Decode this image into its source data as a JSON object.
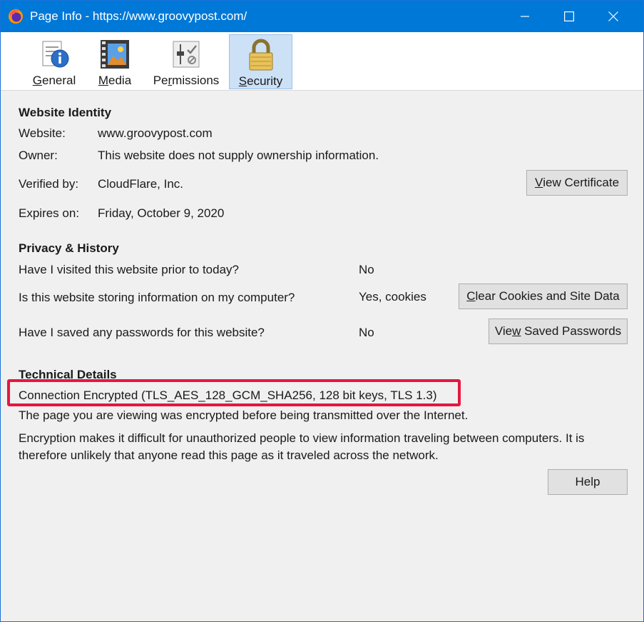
{
  "window": {
    "title": "Page Info - https://www.groovypost.com/",
    "app_icon": "firefox-icon",
    "controls": {
      "minimize": "minimize-icon",
      "maximize": "maximize-icon",
      "close": "close-icon"
    }
  },
  "tabs": [
    {
      "id": "general",
      "label_u": "G",
      "label_rest": "eneral",
      "icon": "info-icon",
      "selected": false
    },
    {
      "id": "media",
      "label_u": "M",
      "label_rest": "edia",
      "icon": "media-icon",
      "selected": false
    },
    {
      "id": "permissions",
      "label_pre": "Pe",
      "label_u": "r",
      "label_rest": "missions",
      "icon": "permissions-icon",
      "selected": false
    },
    {
      "id": "security",
      "label_u": "S",
      "label_rest": "ecurity",
      "icon": "lock-icon",
      "selected": true
    }
  ],
  "identity": {
    "heading": "Website Identity",
    "website_label": "Website:",
    "website_value": "www.groovypost.com",
    "owner_label": "Owner:",
    "owner_value": "This website does not supply ownership information.",
    "verified_label": "Verified by:",
    "verified_value": "CloudFlare, Inc.",
    "expires_label": "Expires on:",
    "expires_value": "Friday, October 9, 2020",
    "view_certificate_u": "V",
    "view_certificate_rest": "iew Certificate"
  },
  "privacy": {
    "heading": "Privacy & History",
    "visited_q": "Have I visited this website prior to today?",
    "visited_a": "No",
    "storing_q": "Is this website storing information on my computer?",
    "storing_a": "Yes, cookies",
    "clear_u": "C",
    "clear_rest": "lear Cookies and Site Data",
    "passwords_q": "Have I saved any passwords for this website?",
    "passwords_a": "No",
    "view_pw_pre": "Vie",
    "view_pw_u": "w",
    "view_pw_rest": " Saved Passwords"
  },
  "technical": {
    "heading": "Technical Details",
    "connection": "Connection Encrypted (TLS_AES_128_GCM_SHA256, 128 bit keys, TLS 1.3)",
    "line1": "The page you are viewing was encrypted before being transmitted over the Internet.",
    "line2": "Encryption makes it difficult for unauthorized people to view information traveling between computers. It is therefore unlikely that anyone read this page as it traveled across the network."
  },
  "help_button": "Help",
  "colors": {
    "titlebar": "#0078d7",
    "selected_tab": "#cce0f6",
    "highlight": "#e5173f"
  }
}
